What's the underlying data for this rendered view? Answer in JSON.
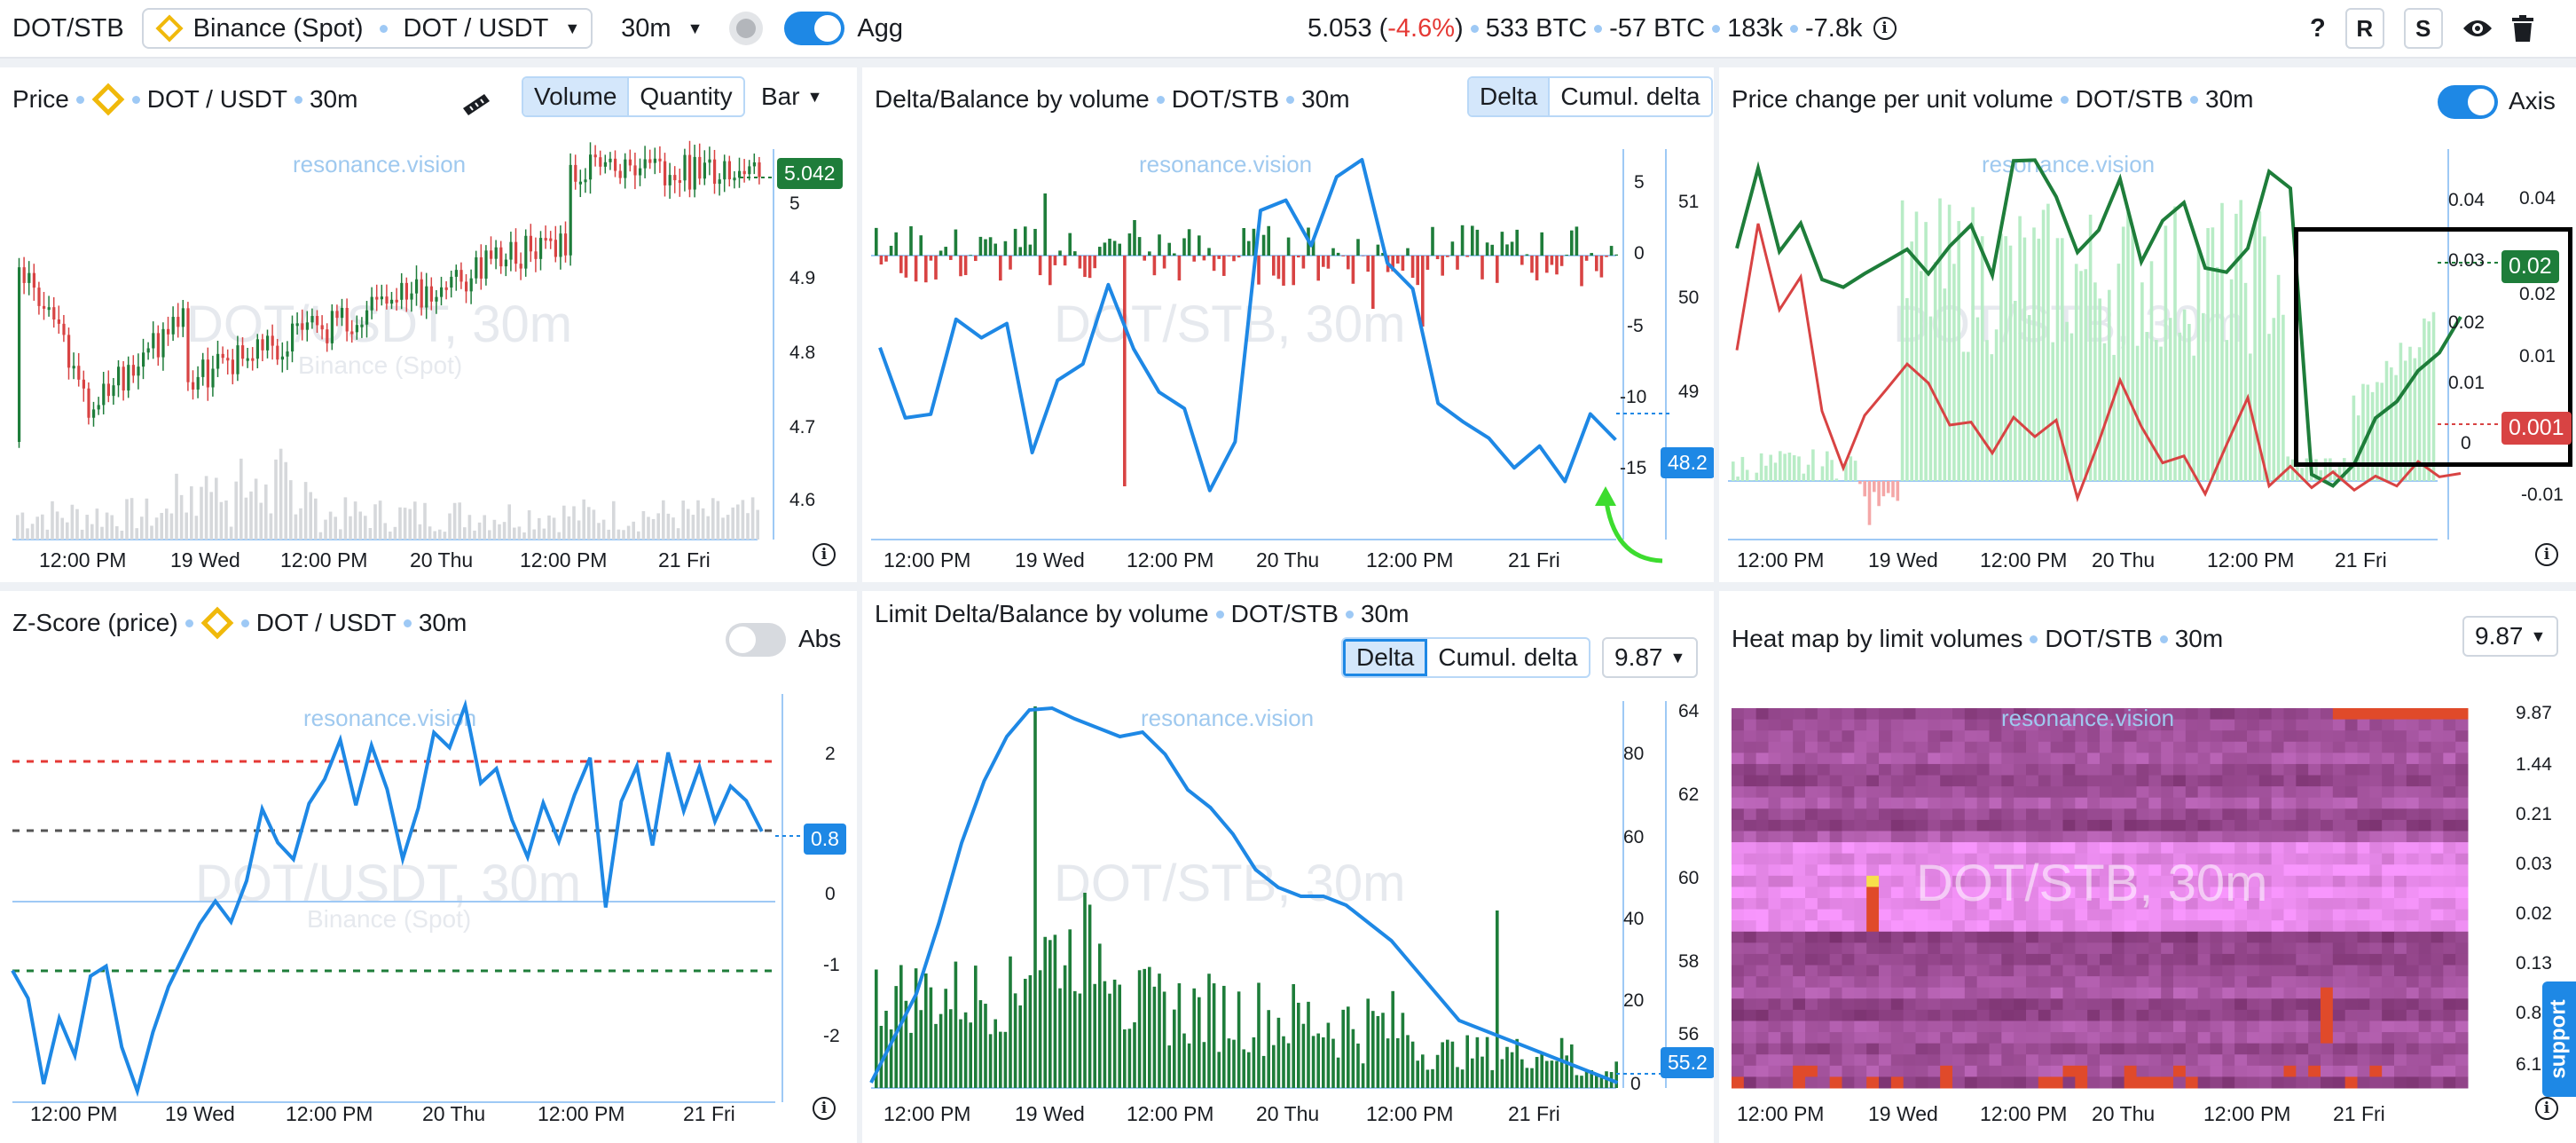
{
  "topbar": {
    "symbol": "DOT/STB",
    "exchange": "Binance (Spot)",
    "pair": "DOT / USDT",
    "timeframe": "30m",
    "agg_label": "Agg",
    "price": "5.053",
    "change": "-4.6%",
    "stat1": "533 BTC",
    "stat2": "-57 BTC",
    "stat3": "183k",
    "stat4": "-7.8k",
    "help": "?",
    "btn_r": "R",
    "btn_s": "S"
  },
  "watermark": "resonance.vision",
  "support_label": "support",
  "panels": {
    "price": {
      "title": "Price",
      "pair": "DOT / USDT",
      "tf": "30m",
      "seg": [
        "Volume",
        "Quantity"
      ],
      "chart_type": "Bar",
      "wm": "DOT/USDT, 30m",
      "wm_sub": "Binance (Spot)",
      "last": "5.042",
      "y_ticks": [
        "5",
        "4.9",
        "4.8",
        "4.7",
        "4.6"
      ],
      "x_ticks": [
        "12:00 PM",
        "19 Wed",
        "12:00 PM",
        "20 Thu",
        "12:00 PM",
        "21 Fri"
      ]
    },
    "delta": {
      "title": "Delta/Balance by volume",
      "pair": "DOT/STB",
      "tf": "30m",
      "seg": [
        "Delta",
        "Cumul. delta"
      ],
      "wm": "DOT/STB, 30m",
      "last": "48.2",
      "y_left": [
        "5",
        "0",
        "-5",
        "-10",
        "-15"
      ],
      "y_right": [
        "51",
        "50",
        "49"
      ],
      "x_ticks": [
        "12:00 PM",
        "19 Wed",
        "12:00 PM",
        "20 Thu",
        "12:00 PM",
        "21 Fri"
      ]
    },
    "pcv": {
      "title": "Price change per unit volume",
      "pair": "DOT/STB",
      "tf": "30m",
      "axis_label": "Axis",
      "wm": "DOT/STB, 30m",
      "tag_green": "0.02",
      "tag_red": "0.001",
      "y_inner": [
        "0.04",
        "0.03",
        "0.02",
        "0.01",
        "0"
      ],
      "y_outer": [
        "0.04",
        "0.03",
        "0.02",
        "0.01",
        "0",
        "-0.01"
      ],
      "x_ticks": [
        "12:00 PM",
        "19 Wed",
        "12:00 PM",
        "20 Thu",
        "12:00 PM",
        "21 Fri"
      ]
    },
    "zscore": {
      "title": "Z-Score (price)",
      "pair": "DOT / USDT",
      "tf": "30m",
      "abs_label": "Abs",
      "wm": "DOT/USDT, 30m",
      "wm_sub": "Binance (Spot)",
      "last": "0.8",
      "y_ticks": [
        "2",
        "1",
        "0",
        "-1",
        "-2"
      ],
      "x_ticks": [
        "12:00 PM",
        "19 Wed",
        "12:00 PM",
        "20 Thu",
        "12:00 PM",
        "21 Fri"
      ]
    },
    "limit": {
      "title": "Limit Delta/Balance by volume",
      "pair": "DOT/STB",
      "tf": "30m",
      "seg": [
        "Delta",
        "Cumul. delta"
      ],
      "level": "9.87",
      "wm": "DOT/STB, 30m",
      "last": "55.2",
      "y_left": [
        "80",
        "60",
        "40",
        "20",
        "0"
      ],
      "y_right": [
        "64",
        "62",
        "60",
        "58",
        "56"
      ],
      "x_ticks": [
        "12:00 PM",
        "19 Wed",
        "12:00 PM",
        "20 Thu",
        "12:00 PM",
        "21 Fri"
      ]
    },
    "heat": {
      "title": "Heat map by limit volumes",
      "pair": "DOT/STB",
      "tf": "30m",
      "level": "9.87",
      "wm": "DOT/STB, 30m",
      "y_ticks": [
        "9.87",
        "1.44",
        "0.21",
        "0.03",
        "0.02",
        "0.13",
        "0.8",
        "6.1"
      ],
      "x_ticks": [
        "12:00 PM",
        "19 Wed",
        "12:00 PM",
        "20 Thu",
        "12:00 PM",
        "21 Fri"
      ]
    }
  },
  "colors": {
    "accent": "#1e88e5",
    "up": "#1e7d3a",
    "down": "#d84343",
    "heat": "#5b1a8c"
  }
}
